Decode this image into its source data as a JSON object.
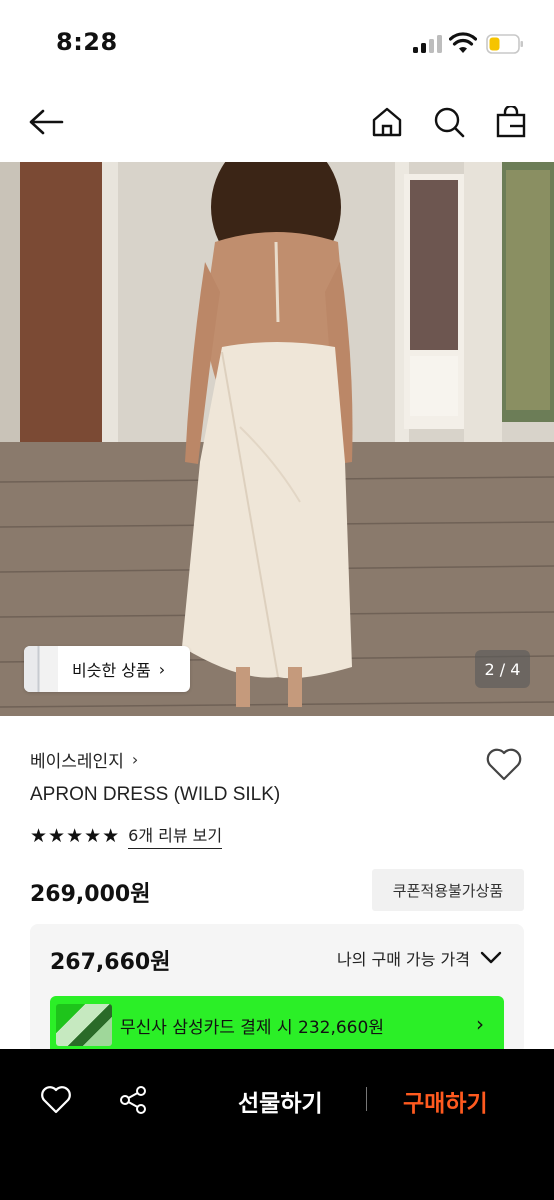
{
  "status_bar": {
    "time": "8:28",
    "icons": [
      "signal-icon",
      "wifi-icon",
      "battery-icon"
    ]
  },
  "header": {
    "icons": [
      "back-arrow-icon",
      "home-icon",
      "search-icon",
      "shopping-bag-icon"
    ]
  },
  "gallery": {
    "similar_label": "비슷한 상품",
    "page_indicator": "2 / 4",
    "current_page": 2,
    "total_pages": 4
  },
  "product": {
    "brand": "베이스레인지",
    "name": "APRON DRESS (WILD SILK)",
    "rating_stars": 5,
    "stars_text": "★★★★★",
    "review_link": "6개 리뷰 보기",
    "price": "269,000원",
    "coupon_badge": "쿠폰적용불가상품"
  },
  "price_box": {
    "my_price": "267,660원",
    "toggle_label": "나의 구매 가능 가격",
    "promo_text": "무신사 삼성카드 결제 시 232,660원",
    "promo_color": "#2bef27"
  },
  "bottom_bar": {
    "icons": [
      "heart-icon",
      "share-icon"
    ],
    "gift_label": "선물하기",
    "buy_label": "구매하기",
    "buy_color": "#ff5a1f"
  }
}
